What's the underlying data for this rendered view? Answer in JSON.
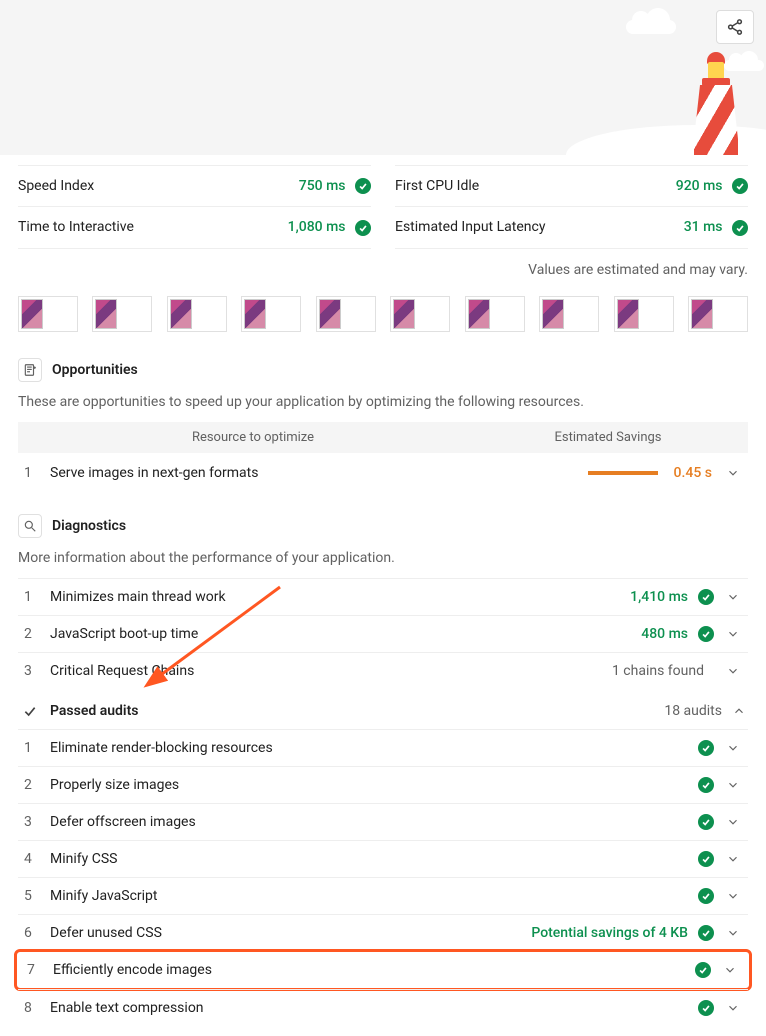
{
  "hero": {
    "share_label": "Share"
  },
  "metrics": [
    {
      "label": "Speed Index",
      "value": "750 ms",
      "pass": true
    },
    {
      "label": "Time to Interactive",
      "value": "1,080 ms",
      "pass": true
    },
    {
      "label": "First CPU Idle",
      "value": "920 ms",
      "pass": true
    },
    {
      "label": "Estimated Input Latency",
      "value": "31 ms",
      "pass": true
    }
  ],
  "estimate_note": "Values are estimated and may vary.",
  "filmstrip_count": 10,
  "opportunities": {
    "title": "Opportunities",
    "desc": "These are opportunities to speed up your application by optimizing the following resources.",
    "col1": "Resource to optimize",
    "col2": "Estimated Savings",
    "rows": [
      {
        "n": "1",
        "text": "Serve images in next-gen formats",
        "value": "0.45 s"
      }
    ]
  },
  "diagnostics": {
    "title": "Diagnostics",
    "desc": "More information about the performance of your application.",
    "rows": [
      {
        "n": "1",
        "text": "Minimizes main thread work",
        "value": "1,410 ms",
        "pass": true
      },
      {
        "n": "2",
        "text": "JavaScript boot-up time",
        "value": "480 ms",
        "pass": true
      },
      {
        "n": "3",
        "text": "Critical Request Chains",
        "value": "1 chains found",
        "pass": false
      }
    ]
  },
  "passed": {
    "title": "Passed audits",
    "count": "18 audits",
    "rows": [
      {
        "n": "1",
        "text": "Eliminate render-blocking resources",
        "extra": ""
      },
      {
        "n": "2",
        "text": "Properly size images",
        "extra": ""
      },
      {
        "n": "3",
        "text": "Defer offscreen images",
        "extra": ""
      },
      {
        "n": "4",
        "text": "Minify CSS",
        "extra": ""
      },
      {
        "n": "5",
        "text": "Minify JavaScript",
        "extra": ""
      },
      {
        "n": "6",
        "text": "Defer unused CSS",
        "extra": "Potential savings of 4 KB"
      },
      {
        "n": "7",
        "text": "Efficiently encode images",
        "extra": "",
        "highlight": true
      },
      {
        "n": "8",
        "text": "Enable text compression",
        "extra": ""
      }
    ]
  }
}
